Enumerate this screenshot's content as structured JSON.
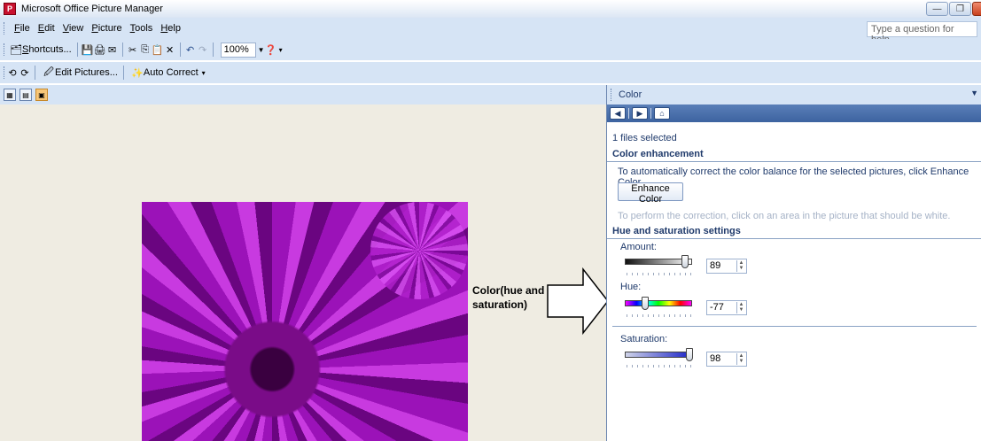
{
  "window": {
    "title": "Microsoft Office Picture Manager",
    "min": "—",
    "max": "❐",
    "close": "✕"
  },
  "menu": {
    "items": [
      {
        "first": "F",
        "rest": "ile"
      },
      {
        "first": "E",
        "rest": "dit"
      },
      {
        "first": "V",
        "rest": "iew"
      },
      {
        "first": "P",
        "rest": "icture"
      },
      {
        "first": "T",
        "rest": "ools"
      },
      {
        "first": "H",
        "rest": "elp"
      }
    ],
    "help_placeholder": "Type a question for help"
  },
  "toolbar1": {
    "shortcuts_first": "S",
    "shortcuts_rest": "hortcuts...",
    "zoom": "100%"
  },
  "toolbar2": {
    "edit_pictures": "Edit Pictures...",
    "auto_correct": "Auto Correct"
  },
  "callout": {
    "line1": "Color(hue and",
    "line2": "saturation)"
  },
  "taskpane": {
    "title": "Color",
    "files_selected": "1 files selected",
    "color_enhancement": {
      "heading": "Color enhancement",
      "description": "To automatically correct the color balance for the selected pictures, click Enhance Color.",
      "button": "Enhance Color",
      "hint": "To perform the correction, click on an area in the picture that should be white."
    },
    "hue_saturation": {
      "heading": "Hue and saturation settings",
      "amount_label": "Amount:",
      "amount_value": "89",
      "amount_fraction": 0.89,
      "hue_label": "Hue:",
      "hue_value": "-77",
      "hue_fraction": 0.3,
      "saturation_label": "Saturation:",
      "saturation_value": "98",
      "saturation_fraction": 0.96
    }
  },
  "colors": {
    "chrome": "#d6e4f5",
    "canvas": "#efece2",
    "link_text": "#1f3a6b",
    "picture_purple": "#9b12b8"
  }
}
